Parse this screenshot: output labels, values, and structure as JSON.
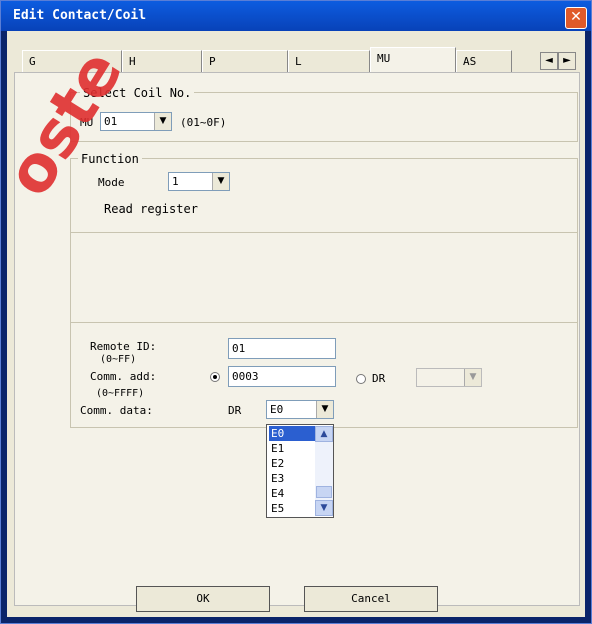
{
  "window": {
    "title": "Edit Contact/Coil",
    "close_icon": "close-icon"
  },
  "tabs": [
    {
      "label": "G"
    },
    {
      "label": "H"
    },
    {
      "label": "P"
    },
    {
      "label": "L"
    },
    {
      "label": "MU",
      "active": true
    },
    {
      "label": "AS"
    }
  ],
  "tab_scroll": {
    "left": "◄",
    "right": "►"
  },
  "select_coil": {
    "legend": "Select Coil No.",
    "prefix": "MU",
    "value": "01",
    "range": "(01~0F)"
  },
  "function": {
    "legend": "Function",
    "mode_label": "Mode",
    "mode_value": "1",
    "description": "Read register"
  },
  "remote": {
    "remote_id_label": "Remote ID:",
    "remote_id_range": "(0~FF)",
    "remote_id_value": "01",
    "comm_add_label": "Comm. add:",
    "comm_add_range": "(0~FFFF)",
    "comm_add_value": "0003",
    "dr_option_label": "DR",
    "comm_data_label": "Comm. data:",
    "comm_data_prefix": "DR",
    "comm_data_value": "E0"
  },
  "dropdown": {
    "options": [
      "E0",
      "E1",
      "E2",
      "E3",
      "E4",
      "E5"
    ],
    "selected": "E0"
  },
  "buttons": {
    "ok": "OK",
    "cancel": "Cancel"
  },
  "watermark": "oste",
  "colors": {
    "title_bar": "#0842b8",
    "dialog_bg": "#ece9d8",
    "close_button": "#e05a2a",
    "selection": "#2b5fd0",
    "watermark": "#e03030"
  }
}
